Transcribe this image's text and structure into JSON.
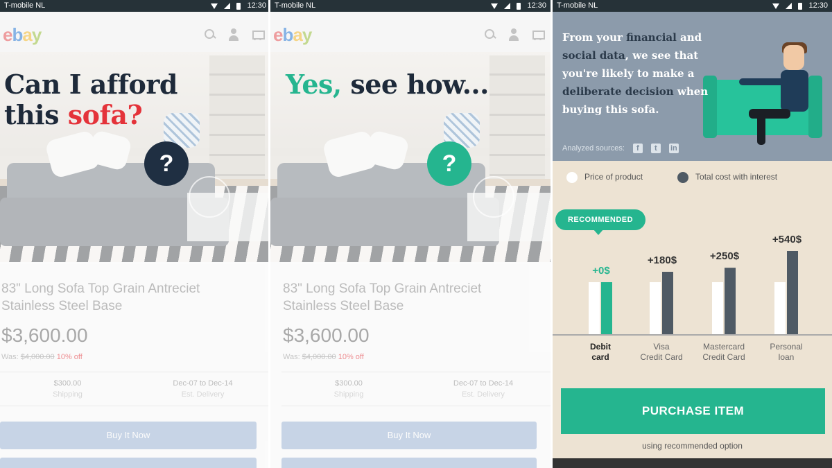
{
  "colors": {
    "accent": "#25b58f",
    "alert": "#e4333a",
    "dark_navy": "#1e2a3a",
    "status_bar": "#263238"
  },
  "status_bar": {
    "carrier_left": "T-mobile NL",
    "carrier_mid": "T-mobile NL",
    "carrier_right": "T-mobile NL",
    "time": "12:30"
  },
  "app": {
    "logo": {
      "e": "e",
      "b": "b",
      "a": "a",
      "y": "y"
    }
  },
  "screen1": {
    "headline_line1": "Can I afford",
    "headline_this": "this ",
    "headline_highlight": "sofa?",
    "question_mark": "?"
  },
  "screen2": {
    "headline_yes": "Yes,",
    "headline_rest": " see how...",
    "question_mark": "?"
  },
  "product": {
    "title": "83\" Long Sofa Top Grain Antreciet Stainless Steel Base",
    "price": "$3,600.00",
    "was_label": "Was: ",
    "was_price": "$4,000.00",
    "discount": "10% off",
    "shipping_value": "$300.00",
    "shipping_label": "Shipping",
    "delivery_value": "Dec-07 to Dec-14",
    "delivery_label": "Est. Delivery",
    "buy_label": "Buy It Now"
  },
  "screen3": {
    "insight": {
      "p1": "From your ",
      "h1": "financial",
      "p2": " and ",
      "h2": "social data",
      "p3": ", we see that you're likely to make a ",
      "h3": "deliberate decision",
      "p4": " when buying this sofa."
    },
    "sources_label": "Analyzed sources:",
    "sources": [
      "f",
      "t",
      "in"
    ],
    "legend": {
      "price": "Price of product",
      "total": "Total cost with interest"
    },
    "recommended_label": "RECOMMENDED",
    "cta_label": "PURCHASE ITEM",
    "cta_sub": "using recommended option"
  },
  "chart_data": {
    "type": "bar",
    "categories": [
      "Debit card",
      "Visa Credit Card",
      "Mastercard Credit Card",
      "Personal loan"
    ],
    "series": [
      {
        "name": "Price of product",
        "values": [
          3600,
          3600,
          3600,
          3600
        ]
      },
      {
        "name": "Total cost with interest",
        "values": [
          3600,
          3780,
          3850,
          4140
        ]
      }
    ],
    "data_labels": [
      "+0$",
      "+180$",
      "+250$",
      "+540$"
    ],
    "recommended_index": 0,
    "series_colors": [
      "#ffffff",
      "#4f5a64"
    ],
    "recommended_color": "#25b58f",
    "ylim": [
      0,
      4500
    ],
    "grid": false,
    "legend_position": "top"
  }
}
